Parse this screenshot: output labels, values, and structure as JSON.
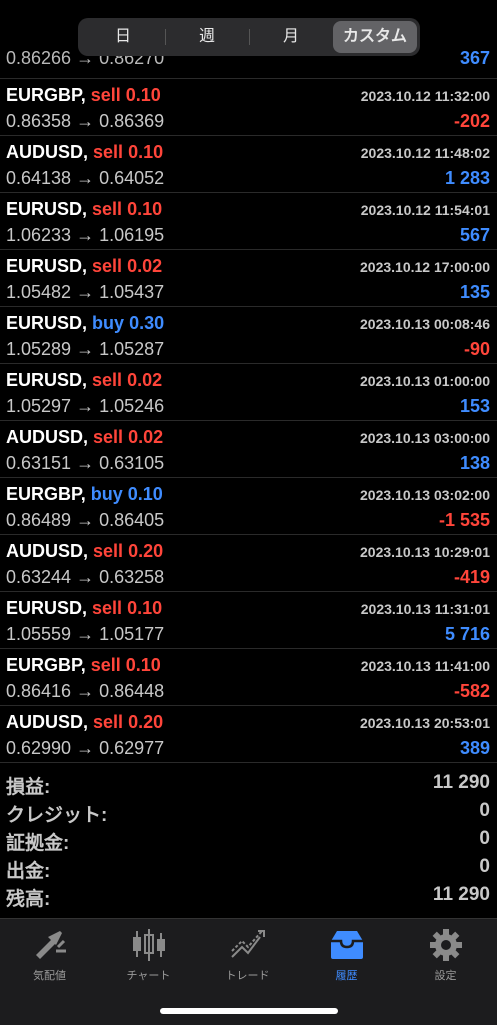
{
  "segments": [
    {
      "label": "日",
      "active": false
    },
    {
      "label": "週",
      "active": false
    },
    {
      "label": "月",
      "active": false
    },
    {
      "label": "カスタム",
      "active": true
    }
  ],
  "partial_row": {
    "price": "0.86266 → 0.86270",
    "profit": "367"
  },
  "trades": [
    {
      "symbol": "EURGBP,",
      "type": "sell",
      "volume": "0.10",
      "time": "2023.10.12 11:32:00",
      "open": "0.86358",
      "close": "0.86369",
      "profit": "-202"
    },
    {
      "symbol": "AUDUSD,",
      "type": "sell",
      "volume": "0.10",
      "time": "2023.10.12 11:48:02",
      "open": "0.64138",
      "close": "0.64052",
      "profit": "1 283"
    },
    {
      "symbol": "EURUSD,",
      "type": "sell",
      "volume": "0.10",
      "time": "2023.10.12 11:54:01",
      "open": "1.06233",
      "close": "1.06195",
      "profit": "567"
    },
    {
      "symbol": "EURUSD,",
      "type": "sell",
      "volume": "0.02",
      "time": "2023.10.12 17:00:00",
      "open": "1.05482",
      "close": "1.05437",
      "profit": "135"
    },
    {
      "symbol": "EURUSD,",
      "type": "buy",
      "volume": "0.30",
      "time": "2023.10.13 00:08:46",
      "open": "1.05289",
      "close": "1.05287",
      "profit": "-90"
    },
    {
      "symbol": "EURUSD,",
      "type": "sell",
      "volume": "0.02",
      "time": "2023.10.13 01:00:00",
      "open": "1.05297",
      "close": "1.05246",
      "profit": "153"
    },
    {
      "symbol": "AUDUSD,",
      "type": "sell",
      "volume": "0.02",
      "time": "2023.10.13 03:00:00",
      "open": "0.63151",
      "close": "0.63105",
      "profit": "138"
    },
    {
      "symbol": "EURGBP,",
      "type": "buy",
      "volume": "0.10",
      "time": "2023.10.13 03:02:00",
      "open": "0.86489",
      "close": "0.86405",
      "profit": "-1 535"
    },
    {
      "symbol": "AUDUSD,",
      "type": "sell",
      "volume": "0.20",
      "time": "2023.10.13 10:29:01",
      "open": "0.63244",
      "close": "0.63258",
      "profit": "-419"
    },
    {
      "symbol": "EURUSD,",
      "type": "sell",
      "volume": "0.10",
      "time": "2023.10.13 11:31:01",
      "open": "1.05559",
      "close": "1.05177",
      "profit": "5 716"
    },
    {
      "symbol": "EURGBP,",
      "type": "sell",
      "volume": "0.10",
      "time": "2023.10.13 11:41:00",
      "open": "0.86416",
      "close": "0.86448",
      "profit": "-582"
    },
    {
      "symbol": "AUDUSD,",
      "type": "sell",
      "volume": "0.20",
      "time": "2023.10.13 20:53:01",
      "open": "0.62990",
      "close": "0.62977",
      "profit": "389"
    }
  ],
  "summary": [
    {
      "label": "損益:",
      "value": "11 290"
    },
    {
      "label": "クレジット:",
      "value": "0"
    },
    {
      "label": "証拠金:",
      "value": "0"
    },
    {
      "label": "出金:",
      "value": "0"
    },
    {
      "label": "残高:",
      "value": "11 290"
    }
  ],
  "tabs": [
    {
      "label": "気配値",
      "icon": "quotes-icon",
      "active": false
    },
    {
      "label": "チャート",
      "icon": "chart-icon",
      "active": false
    },
    {
      "label": "トレード",
      "icon": "trade-icon",
      "active": false
    },
    {
      "label": "履歴",
      "icon": "history-icon",
      "active": true
    },
    {
      "label": "設定",
      "icon": "settings-icon",
      "active": false
    }
  ],
  "colors": {
    "sell": "#ff453a",
    "buy": "#3f8cff",
    "negative": "#ff453a",
    "positive": "#3f8cff",
    "active_tab": "#3f8cff"
  }
}
